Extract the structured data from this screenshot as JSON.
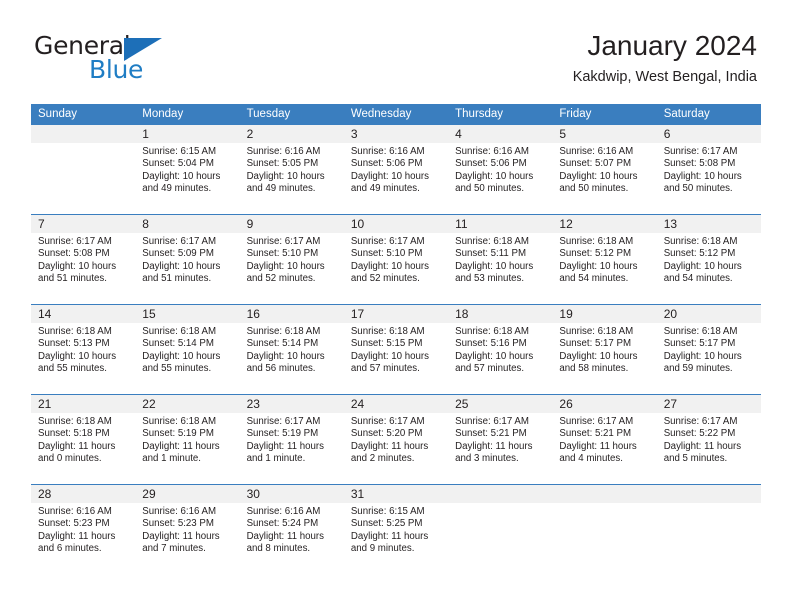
{
  "logo": {
    "word1": "General",
    "word2": "Blue"
  },
  "header": {
    "title": "January 2024",
    "subtitle": "Kakdwip, West Bengal, India"
  },
  "labels": {
    "sunrise_prefix": "Sunrise:",
    "sunset_prefix": "Sunset:",
    "daylight_prefix": "Daylight:"
  },
  "colors": {
    "header_blue": "#3a7ebf",
    "logo_blue": "#1f7dc4",
    "day_band": "#f1f1f1",
    "text": "#231f20"
  },
  "weekdays": [
    "Sunday",
    "Monday",
    "Tuesday",
    "Wednesday",
    "Thursday",
    "Friday",
    "Saturday"
  ],
  "weeks": [
    [
      {
        "day": "",
        "sunrise": "",
        "sunset": "",
        "daylight": "",
        "empty": true
      },
      {
        "day": "1",
        "sunrise": "Sunrise: 6:15 AM",
        "sunset": "Sunset: 5:04 PM",
        "daylight": "Daylight: 10 hours and 49 minutes."
      },
      {
        "day": "2",
        "sunrise": "Sunrise: 6:16 AM",
        "sunset": "Sunset: 5:05 PM",
        "daylight": "Daylight: 10 hours and 49 minutes."
      },
      {
        "day": "3",
        "sunrise": "Sunrise: 6:16 AM",
        "sunset": "Sunset: 5:06 PM",
        "daylight": "Daylight: 10 hours and 49 minutes."
      },
      {
        "day": "4",
        "sunrise": "Sunrise: 6:16 AM",
        "sunset": "Sunset: 5:06 PM",
        "daylight": "Daylight: 10 hours and 50 minutes."
      },
      {
        "day": "5",
        "sunrise": "Sunrise: 6:16 AM",
        "sunset": "Sunset: 5:07 PM",
        "daylight": "Daylight: 10 hours and 50 minutes."
      },
      {
        "day": "6",
        "sunrise": "Sunrise: 6:17 AM",
        "sunset": "Sunset: 5:08 PM",
        "daylight": "Daylight: 10 hours and 50 minutes."
      }
    ],
    [
      {
        "day": "7",
        "sunrise": "Sunrise: 6:17 AM",
        "sunset": "Sunset: 5:08 PM",
        "daylight": "Daylight: 10 hours and 51 minutes."
      },
      {
        "day": "8",
        "sunrise": "Sunrise: 6:17 AM",
        "sunset": "Sunset: 5:09 PM",
        "daylight": "Daylight: 10 hours and 51 minutes."
      },
      {
        "day": "9",
        "sunrise": "Sunrise: 6:17 AM",
        "sunset": "Sunset: 5:10 PM",
        "daylight": "Daylight: 10 hours and 52 minutes."
      },
      {
        "day": "10",
        "sunrise": "Sunrise: 6:17 AM",
        "sunset": "Sunset: 5:10 PM",
        "daylight": "Daylight: 10 hours and 52 minutes."
      },
      {
        "day": "11",
        "sunrise": "Sunrise: 6:18 AM",
        "sunset": "Sunset: 5:11 PM",
        "daylight": "Daylight: 10 hours and 53 minutes."
      },
      {
        "day": "12",
        "sunrise": "Sunrise: 6:18 AM",
        "sunset": "Sunset: 5:12 PM",
        "daylight": "Daylight: 10 hours and 54 minutes."
      },
      {
        "day": "13",
        "sunrise": "Sunrise: 6:18 AM",
        "sunset": "Sunset: 5:12 PM",
        "daylight": "Daylight: 10 hours and 54 minutes."
      }
    ],
    [
      {
        "day": "14",
        "sunrise": "Sunrise: 6:18 AM",
        "sunset": "Sunset: 5:13 PM",
        "daylight": "Daylight: 10 hours and 55 minutes."
      },
      {
        "day": "15",
        "sunrise": "Sunrise: 6:18 AM",
        "sunset": "Sunset: 5:14 PM",
        "daylight": "Daylight: 10 hours and 55 minutes."
      },
      {
        "day": "16",
        "sunrise": "Sunrise: 6:18 AM",
        "sunset": "Sunset: 5:14 PM",
        "daylight": "Daylight: 10 hours and 56 minutes."
      },
      {
        "day": "17",
        "sunrise": "Sunrise: 6:18 AM",
        "sunset": "Sunset: 5:15 PM",
        "daylight": "Daylight: 10 hours and 57 minutes."
      },
      {
        "day": "18",
        "sunrise": "Sunrise: 6:18 AM",
        "sunset": "Sunset: 5:16 PM",
        "daylight": "Daylight: 10 hours and 57 minutes."
      },
      {
        "day": "19",
        "sunrise": "Sunrise: 6:18 AM",
        "sunset": "Sunset: 5:17 PM",
        "daylight": "Daylight: 10 hours and 58 minutes."
      },
      {
        "day": "20",
        "sunrise": "Sunrise: 6:18 AM",
        "sunset": "Sunset: 5:17 PM",
        "daylight": "Daylight: 10 hours and 59 minutes."
      }
    ],
    [
      {
        "day": "21",
        "sunrise": "Sunrise: 6:18 AM",
        "sunset": "Sunset: 5:18 PM",
        "daylight": "Daylight: 11 hours and 0 minutes."
      },
      {
        "day": "22",
        "sunrise": "Sunrise: 6:18 AM",
        "sunset": "Sunset: 5:19 PM",
        "daylight": "Daylight: 11 hours and 1 minute."
      },
      {
        "day": "23",
        "sunrise": "Sunrise: 6:17 AM",
        "sunset": "Sunset: 5:19 PM",
        "daylight": "Daylight: 11 hours and 1 minute."
      },
      {
        "day": "24",
        "sunrise": "Sunrise: 6:17 AM",
        "sunset": "Sunset: 5:20 PM",
        "daylight": "Daylight: 11 hours and 2 minutes."
      },
      {
        "day": "25",
        "sunrise": "Sunrise: 6:17 AM",
        "sunset": "Sunset: 5:21 PM",
        "daylight": "Daylight: 11 hours and 3 minutes."
      },
      {
        "day": "26",
        "sunrise": "Sunrise: 6:17 AM",
        "sunset": "Sunset: 5:21 PM",
        "daylight": "Daylight: 11 hours and 4 minutes."
      },
      {
        "day": "27",
        "sunrise": "Sunrise: 6:17 AM",
        "sunset": "Sunset: 5:22 PM",
        "daylight": "Daylight: 11 hours and 5 minutes."
      }
    ],
    [
      {
        "day": "28",
        "sunrise": "Sunrise: 6:16 AM",
        "sunset": "Sunset: 5:23 PM",
        "daylight": "Daylight: 11 hours and 6 minutes."
      },
      {
        "day": "29",
        "sunrise": "Sunrise: 6:16 AM",
        "sunset": "Sunset: 5:23 PM",
        "daylight": "Daylight: 11 hours and 7 minutes."
      },
      {
        "day": "30",
        "sunrise": "Sunrise: 6:16 AM",
        "sunset": "Sunset: 5:24 PM",
        "daylight": "Daylight: 11 hours and 8 minutes."
      },
      {
        "day": "31",
        "sunrise": "Sunrise: 6:15 AM",
        "sunset": "Sunset: 5:25 PM",
        "daylight": "Daylight: 11 hours and 9 minutes."
      },
      {
        "day": "",
        "sunrise": "",
        "sunset": "",
        "daylight": "",
        "empty": true
      },
      {
        "day": "",
        "sunrise": "",
        "sunset": "",
        "daylight": "",
        "empty": true
      },
      {
        "day": "",
        "sunrise": "",
        "sunset": "",
        "daylight": "",
        "empty": true
      }
    ]
  ]
}
